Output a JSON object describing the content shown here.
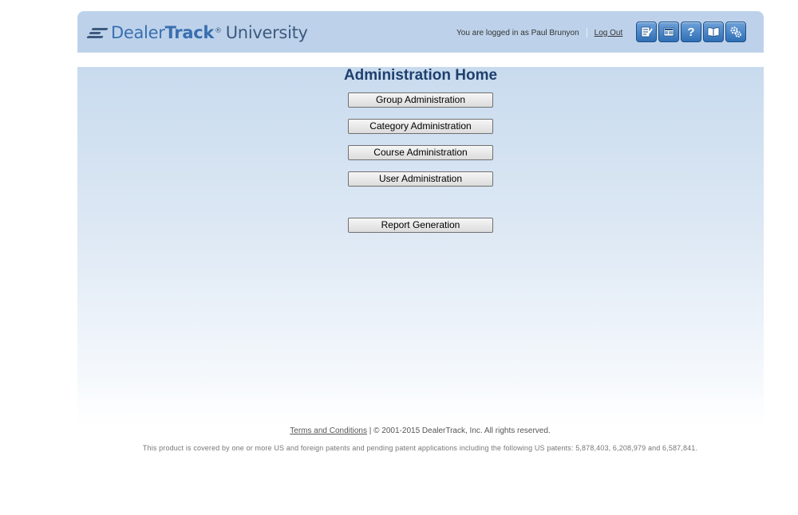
{
  "header": {
    "logo": {
      "dealer": "Dealer",
      "track": "Track",
      "reg": "®",
      "university": "University"
    },
    "login_text": "You are logged in as Paul Brunyon",
    "logout_label": "Log Out",
    "toolbar_icons": [
      "edit-icon",
      "catalog-icon",
      "help-icon",
      "book-icon",
      "settings-icon"
    ],
    "help_glyph": "?"
  },
  "main": {
    "title": "Administration Home",
    "buttons": [
      "Group Administration",
      "Category Administration",
      "Course Administration",
      "User Administration",
      "Report Generation"
    ]
  },
  "footer": {
    "terms_label": "Terms and Conditions",
    "copyright": "| © 2001-2015 DealerTrack, Inc. All rights reserved.",
    "patents": "This product is covered by one or more US and foreign patents and pending patent applications including the following US patents: 5,878,403, 6,208,979 and 6,587,841."
  },
  "colors": {
    "header_bg": "#bdd2ea",
    "title": "#1f3f6e",
    "logo_blue": "#3a6fb0"
  }
}
